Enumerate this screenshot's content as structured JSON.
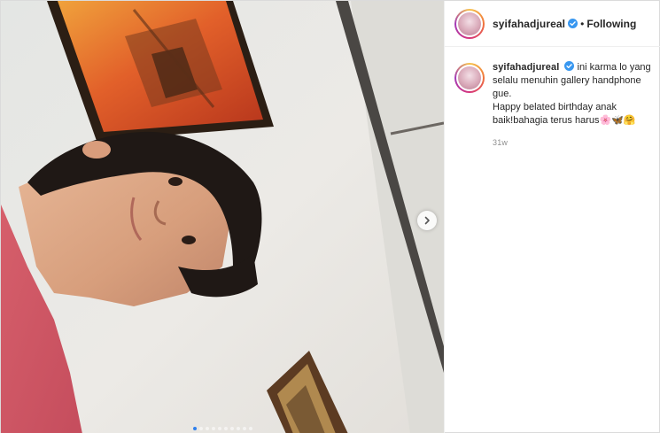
{
  "post": {
    "username": "syifahadjureal",
    "verified": true,
    "header_separator": "•",
    "follow_status": "Following",
    "caption": {
      "first_line": "ini karma lo yang selalu menuhin gallery handphone gue.",
      "second_line": "Happy belated birthday anak baik!bahagia terus harus",
      "emojis": [
        "🌸",
        "🦋",
        "🤗"
      ]
    },
    "timestamp": "31w"
  },
  "carousel": {
    "slide_count": 10,
    "active_index": 0
  },
  "colors": {
    "verified_blue": "#3897f0",
    "active_dot": "#2f80ed"
  },
  "icons": {
    "next": "chevron-right-icon",
    "verified": "verified-badge-icon"
  }
}
